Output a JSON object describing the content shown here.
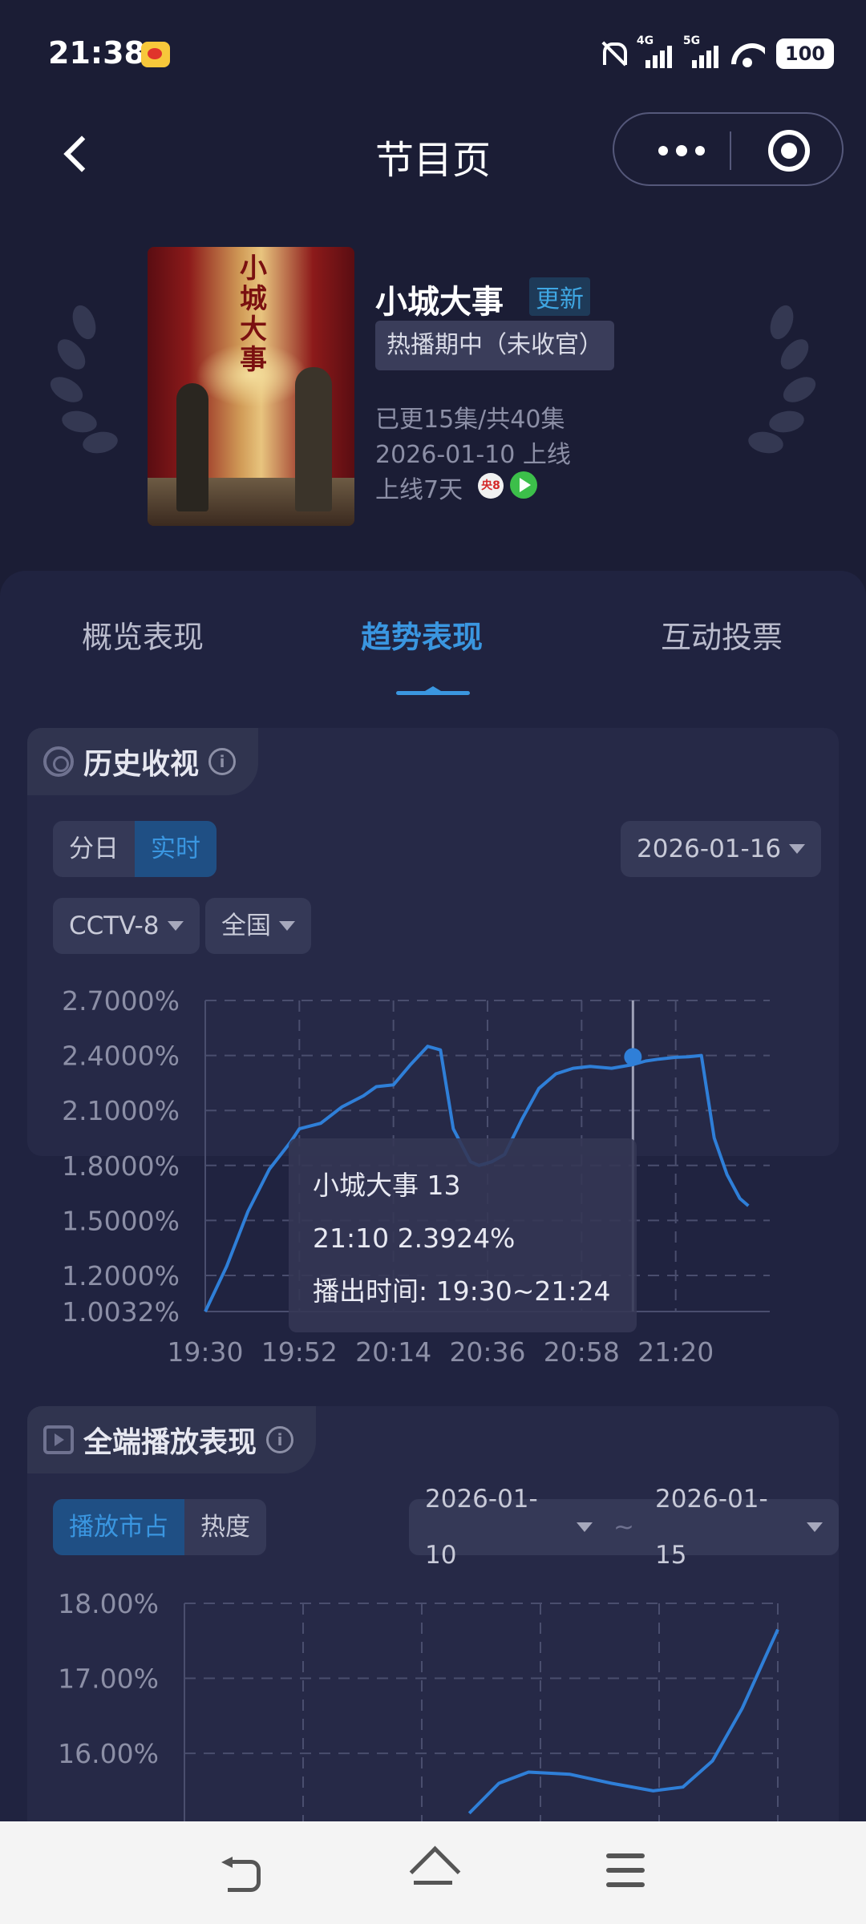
{
  "status_bar": {
    "time": "21:38",
    "net1": "4G",
    "net2": "5G",
    "battery": "100"
  },
  "nav": {
    "title": "节目页"
  },
  "program": {
    "poster_title": "小城大事",
    "name": "小城大事",
    "badge": "更新",
    "status": "热播期中（未收官）",
    "episodes": "已更15集/共40集",
    "premiere": "2026-01-10 上线",
    "days_online": "上线7天",
    "channel_icon": "央8"
  },
  "tabs": [
    {
      "label": "概览表现",
      "active": false
    },
    {
      "label": "趋势表现",
      "active": true
    },
    {
      "label": "互动投票",
      "active": false
    }
  ],
  "history": {
    "title": "历史收视",
    "seg": [
      "分日",
      "实时"
    ],
    "seg_active": 1,
    "date": "2026-01-16",
    "channel": "CCTV-8",
    "region": "全国",
    "tooltip": {
      "line1": "小城大事 13",
      "line2": "21:10 2.3924%",
      "line3": "播出时间: 19:30~21:24"
    }
  },
  "playback": {
    "title": "全端播放表现",
    "seg": [
      "播放市占",
      "热度"
    ],
    "seg_active": 0,
    "date_from": "2026-01-10",
    "date_to": "2026-01-15",
    "tilde": "~"
  },
  "chart_data": [
    {
      "type": "line",
      "y_unit": "%",
      "ylim": [
        1.0032,
        2.7
      ],
      "y_ticks": [
        "2.7000%",
        "2.4000%",
        "2.1000%",
        "1.8000%",
        "1.5000%",
        "1.2000%",
        "1.0032%"
      ],
      "y_tick_values": [
        2.7,
        2.4,
        2.1,
        1.8,
        1.5,
        1.2,
        1.0032
      ],
      "x_ticks": [
        "19:30",
        "19:52",
        "20:14",
        "20:36",
        "20:58",
        "21:20"
      ],
      "x_minutes": [
        0,
        5,
        10,
        15,
        20,
        22,
        27,
        32,
        37,
        40,
        44,
        48,
        52,
        55,
        58,
        62,
        64,
        67,
        70,
        74,
        78,
        82,
        86,
        90,
        95,
        100,
        103,
        106,
        110,
        113,
        116,
        119,
        122,
        125,
        127
      ],
      "values": [
        1.0032,
        1.25,
        1.55,
        1.78,
        1.93,
        2.0,
        2.03,
        2.12,
        2.18,
        2.23,
        2.24,
        2.35,
        2.45,
        2.43,
        2.0,
        1.82,
        1.8,
        1.82,
        1.86,
        2.05,
        2.22,
        2.3,
        2.33,
        2.34,
        2.33,
        2.35,
        2.37,
        2.38,
        2.39,
        2.3924,
        2.4,
        1.95,
        1.75,
        1.62,
        1.58
      ],
      "highlight": {
        "x": "21:10",
        "value": 2.3924
      },
      "grid": true
    },
    {
      "type": "line",
      "y_unit": "%",
      "y_ticks": [
        "18.00%",
        "17.00%",
        "16.00%"
      ],
      "y_tick_values": [
        18.0,
        17.0,
        16.0
      ],
      "ylim_visible": [
        15.2,
        18.0
      ],
      "x_fraction": [
        0.48,
        0.53,
        0.58,
        0.65,
        0.72,
        0.79,
        0.84,
        0.89,
        0.94,
        1.0
      ],
      "values": [
        15.2,
        15.6,
        15.75,
        15.72,
        15.6,
        15.5,
        15.55,
        15.9,
        16.6,
        17.65
      ],
      "grid": true
    }
  ],
  "colors": {
    "accent": "#3a96e0",
    "line": "#2f7fd8",
    "background": "#1b1d35",
    "panel": "#202340"
  }
}
